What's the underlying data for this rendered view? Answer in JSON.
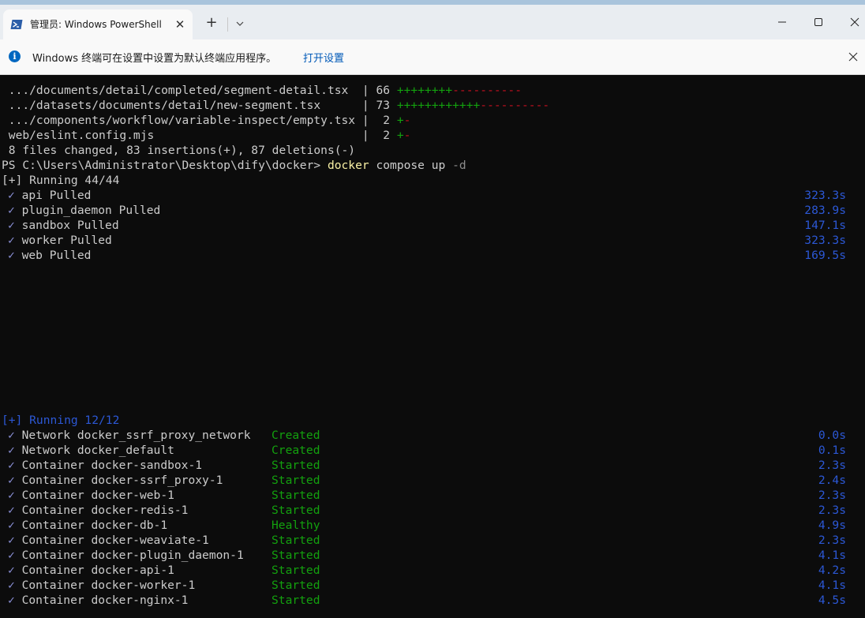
{
  "window": {
    "tab_title": "管理员: Windows PowerShell",
    "tab_icon": "powershell-icon",
    "accent": "#a9c4dc"
  },
  "infobar": {
    "message": "Windows 终端可在设置中设置为默认终端应用程序。",
    "link": "打开设置"
  },
  "git_stats": [
    {
      "path": " .../documents/detail/completed/segment-detail.tsx  ",
      "count": " 66 ",
      "plus": "++++++++",
      "minus": "----------"
    },
    {
      "path": " .../datasets/documents/detail/new-segment.tsx      ",
      "count": " 73 ",
      "plus": "++++++++++++",
      "minus": "----------"
    },
    {
      "path": " .../components/workflow/variable-inspect/empty.tsx ",
      "count": "  2 ",
      "plus": "+",
      "minus": "-"
    },
    {
      "path": " web/eslint.config.mjs                              ",
      "count": "  2 ",
      "plus": "+",
      "minus": "-"
    }
  ],
  "git_summary": " 8 files changed, 83 insertions(+), 87 deletions(-)",
  "prompt": {
    "path": "PS C:\\Users\\Administrator\\Desktop\\dify\\docker> ",
    "cmd": "docker",
    "args": " compose up ",
    "flag": "-d"
  },
  "pull": {
    "header": "[+] Running 44/44",
    "items": [
      {
        "name": "api Pulled",
        "time": "323.3s"
      },
      {
        "name": "plugin_daemon Pulled",
        "time": "283.9s"
      },
      {
        "name": "sandbox Pulled",
        "time": "147.1s"
      },
      {
        "name": "worker Pulled",
        "time": "323.3s"
      },
      {
        "name": "web Pulled",
        "time": "169.5s"
      }
    ]
  },
  "run": {
    "header": "[+] Running 12/12",
    "items": [
      {
        "name": "Network docker_ssrf_proxy_network",
        "status": "Created",
        "time": "0.0s"
      },
      {
        "name": "Network docker_default",
        "status": "Created",
        "time": "0.1s"
      },
      {
        "name": "Container docker-sandbox-1",
        "status": "Started",
        "time": "2.3s"
      },
      {
        "name": "Container docker-ssrf_proxy-1",
        "status": "Started",
        "time": "2.4s"
      },
      {
        "name": "Container docker-web-1",
        "status": "Started",
        "time": "2.3s"
      },
      {
        "name": "Container docker-redis-1",
        "status": "Started",
        "time": "2.3s"
      },
      {
        "name": "Container docker-db-1",
        "status": "Healthy",
        "time": "4.9s"
      },
      {
        "name": "Container docker-weaviate-1",
        "status": "Started",
        "time": "2.3s"
      },
      {
        "name": "Container docker-plugin_daemon-1",
        "status": "Started",
        "time": "4.1s"
      },
      {
        "name": "Container docker-api-1",
        "status": "Started",
        "time": "4.2s"
      },
      {
        "name": "Container docker-worker-1",
        "status": "Started",
        "time": "4.1s"
      },
      {
        "name": "Container docker-nginx-1",
        "status": "Started",
        "time": "4.5s"
      }
    ]
  }
}
